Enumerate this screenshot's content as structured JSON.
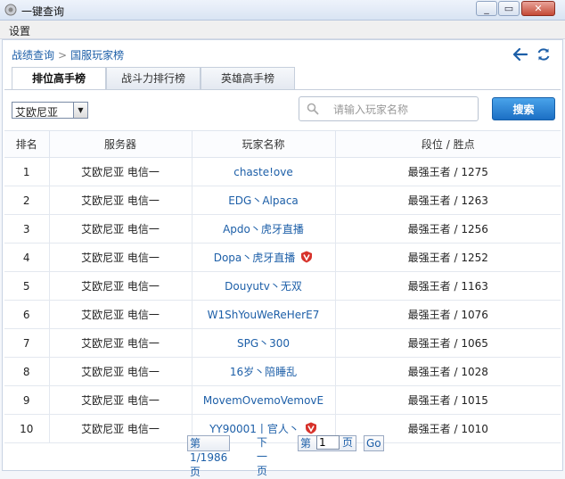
{
  "window": {
    "title": "一键查询"
  },
  "menu": {
    "settings": "设置"
  },
  "breadcrumb": {
    "parent": "战绩查询",
    "current": "国服玩家榜"
  },
  "tabs": [
    {
      "label": "排位高手榜",
      "active": true
    },
    {
      "label": "战斗力排行榜",
      "active": false
    },
    {
      "label": "英雄高手榜",
      "active": false
    }
  ],
  "filter": {
    "server_selected": "艾欧尼亚"
  },
  "search": {
    "placeholder": "请输入玩家名称",
    "button": "搜索"
  },
  "table": {
    "headers": [
      "排名",
      "服务器",
      "玩家名称",
      "段位 / 胜点"
    ],
    "rows": [
      {
        "rank": "1",
        "server": "艾欧尼亚 电信一",
        "name": "chaste!ove",
        "tier": "最强王者 / 1275",
        "badge": false
      },
      {
        "rank": "2",
        "server": "艾欧尼亚 电信一",
        "name": "EDG丶Alpaca",
        "tier": "最强王者 / 1263",
        "badge": false
      },
      {
        "rank": "3",
        "server": "艾欧尼亚 电信一",
        "name": "Apdo丶虎牙直播",
        "tier": "最强王者 / 1256",
        "badge": false
      },
      {
        "rank": "4",
        "server": "艾欧尼亚 电信一",
        "name": "Dopa丶虎牙直播",
        "tier": "最强王者 / 1252",
        "badge": true
      },
      {
        "rank": "5",
        "server": "艾欧尼亚 电信一",
        "name": "Douyutv丶无双",
        "tier": "最强王者 / 1163",
        "badge": false
      },
      {
        "rank": "6",
        "server": "艾欧尼亚 电信一",
        "name": "W1ShYouWeReHerE7",
        "tier": "最强王者 / 1076",
        "badge": false
      },
      {
        "rank": "7",
        "server": "艾欧尼亚 电信一",
        "name": "SPG丶300",
        "tier": "最强王者 / 1065",
        "badge": false
      },
      {
        "rank": "8",
        "server": "艾欧尼亚 电信一",
        "name": "16岁丶陪睡乱",
        "tier": "最强王者 / 1028",
        "badge": false
      },
      {
        "rank": "9",
        "server": "艾欧尼亚 电信一",
        "name": "MovemOvemoVemovE",
        "tier": "最强王者 / 1015",
        "badge": false
      },
      {
        "rank": "10",
        "server": "艾欧尼亚 电信一",
        "name": "YY90001丨官人丶",
        "tier": "最强王者 / 1010",
        "badge": true
      }
    ]
  },
  "pager": {
    "page_info": "第1/1986页",
    "next": "下一页",
    "goto_prefix": "第",
    "goto_value": "1",
    "goto_suffix": "页",
    "go": "Go"
  },
  "colors": {
    "link": "#1d5fa8",
    "button": "#1b6fc4",
    "badge": "#d7322b"
  }
}
